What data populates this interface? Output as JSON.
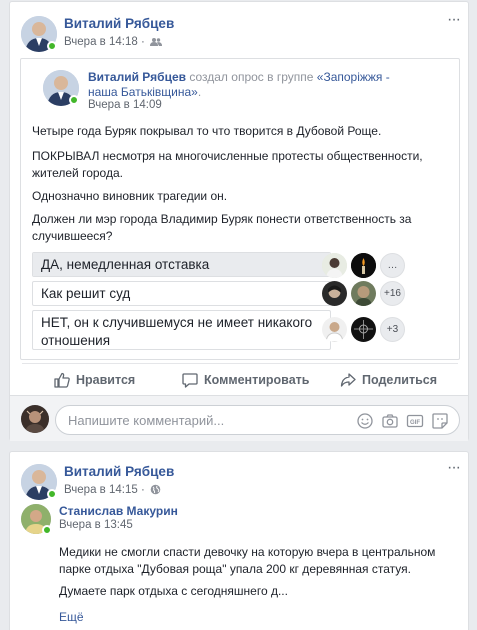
{
  "post1": {
    "author": "Виталий Рябцев",
    "time": "Вчера в 14:18",
    "privacy_icon": "friends-icon",
    "shared": {
      "author": "Виталий Рябцев",
      "action": "создал опрос в группе",
      "group": "«Запоріжжя - наша Батьківщина»",
      "time": "Вчера в 14:09",
      "paragraphs": [
        "Четыре года Буряк покрывал то что творится в Дубовой Роще.",
        "ПОКРЫВАЛ несмотря на многочисленные протесты общественности, жителей города.",
        "Однозначно виновник трагедии он.",
        "Должен ли мэр города Владимир Буряк понести ответственность за случившееся?"
      ],
      "poll": [
        {
          "label": "ДА, немедленная отставка",
          "extra_voters": ""
        },
        {
          "label": "Как решит суд",
          "extra_voters": "+16"
        },
        {
          "label": "НЕТ, он к случившемуся не имеет никакого отношения",
          "extra_voters": "+3"
        }
      ]
    },
    "actions": {
      "like": "Нравится",
      "comment": "Комментировать",
      "share": "Поделиться"
    },
    "comment_placeholder": "Напишите комментарий..."
  },
  "post2": {
    "author": "Виталий Рябцев",
    "time": "Вчера в 14:15",
    "privacy_icon": "globe-icon",
    "comment": {
      "author": "Станислав Макурин",
      "time": "Вчера в 13:45",
      "paragraphs": [
        "Медики не смогли спасти девочку на которую вчера в центральном парке отдыха \"Дубовая роща\" упала 200 кг деревянная статуя.",
        "Думаете парк отдыха с сегодняшнего д..."
      ],
      "see_more": "Ещё"
    }
  },
  "colors": {
    "link": "#365899",
    "online": "#42b72a",
    "background": "#e9ebee"
  }
}
